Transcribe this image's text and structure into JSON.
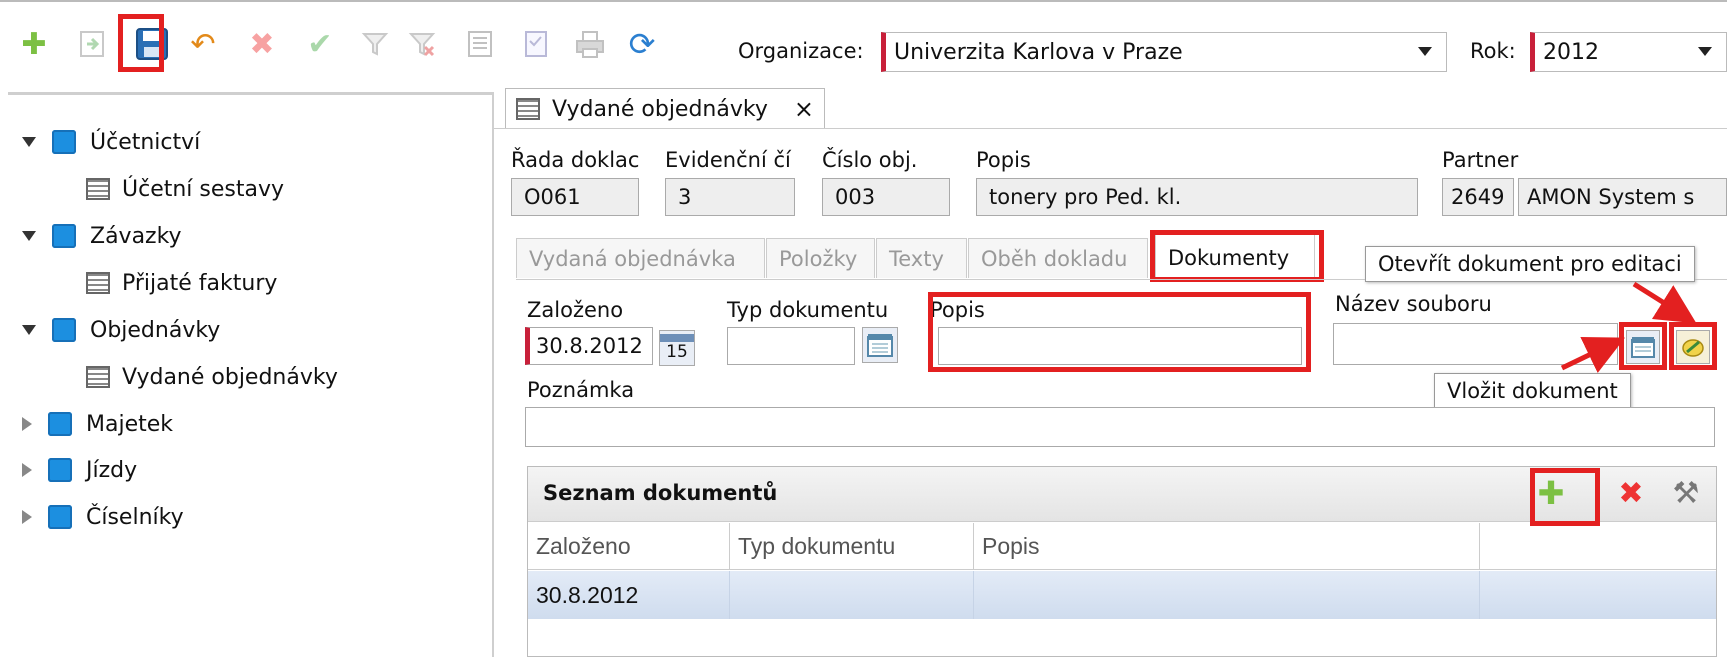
{
  "toolbar": {
    "icons": [
      "add-icon",
      "import-icon",
      "save-icon",
      "undo-icon",
      "delete-icon",
      "confirm-icon",
      "filter-icon",
      "clear-filter-icon",
      "list-icon",
      "checklist-icon",
      "print-icon",
      "refresh-icon"
    ],
    "org_label": "Organizace:",
    "org_value": "Univerzita Karlova v Praze",
    "year_label": "Rok:",
    "year_value": "2012"
  },
  "sidebar": {
    "items": [
      {
        "label": "Účetnictví",
        "type": "folder",
        "state": "open"
      },
      {
        "label": "Účetní sestavy",
        "type": "report"
      },
      {
        "label": "Závazky",
        "type": "folder",
        "state": "open"
      },
      {
        "label": "Přijaté faktury",
        "type": "report"
      },
      {
        "label": "Objednávky",
        "type": "folder",
        "state": "open"
      },
      {
        "label": "Vydané objednávky",
        "type": "report"
      },
      {
        "label": "Majetek",
        "type": "folder",
        "state": "closed"
      },
      {
        "label": "Jízdy",
        "type": "folder",
        "state": "closed"
      },
      {
        "label": "Číselníky",
        "type": "folder",
        "state": "closed"
      }
    ]
  },
  "main_tab": {
    "label": "Vydané objednávky",
    "close": "×"
  },
  "header_fields": {
    "rada_label": "Řada doklac",
    "rada_value": "O061",
    "evid_label": "Evidenční čí",
    "evid_value": "3",
    "cislo_label": "Číslo obj.",
    "cislo_value": "003",
    "popis_label": "Popis",
    "popis_value": "tonery pro Ped. kl.",
    "partner_label": "Partner",
    "partner_code": "2649",
    "partner_name": "AMON  System  s"
  },
  "subtabs": [
    "Vydaná objednávka",
    "Položky",
    "Texty",
    "Oběh dokladu",
    "Dokumenty"
  ],
  "doc_form": {
    "zalozeno_label": "Založeno",
    "zalozeno_value": "30.8.2012",
    "typ_label": "Typ dokumentu",
    "popis_label": "Popis",
    "nazev_label": "Název souboru",
    "poznamka_label": "Poznámka",
    "cal_day": "15"
  },
  "tooltips": {
    "open_edit": "Otevřít dokument pro editaci",
    "insert": "Vložit dokument"
  },
  "grid": {
    "title": "Seznam dokumentů",
    "columns": [
      "Založeno",
      "Typ dokumentu",
      "Popis"
    ],
    "rows": [
      [
        "30.8.2012",
        "",
        ""
      ]
    ]
  },
  "colors": {
    "highlight": "#e32020",
    "required": "#c8203a",
    "selected_row": "#dce6f4"
  }
}
